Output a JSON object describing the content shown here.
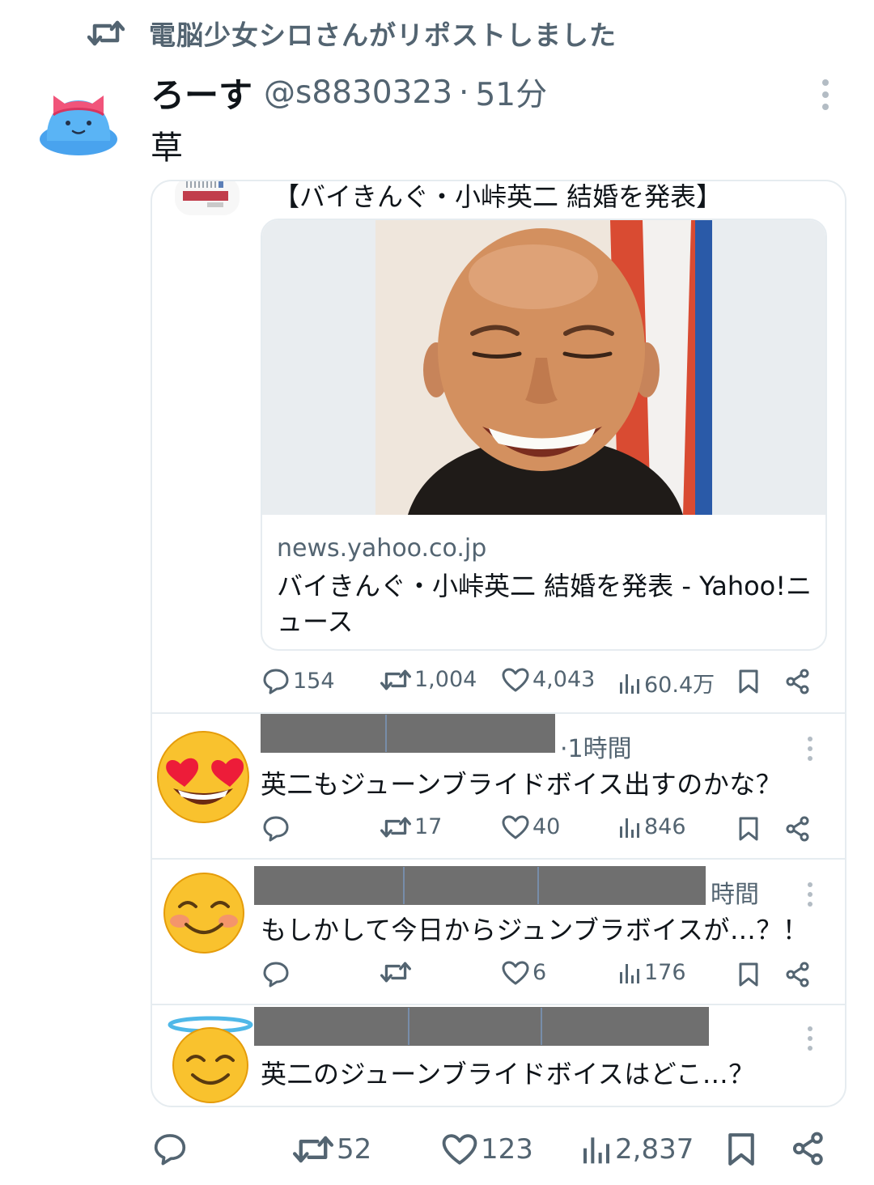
{
  "repost": {
    "icon": "repost-icon",
    "label": "電脳少女シロさんがリポストしました"
  },
  "tweet": {
    "author_name": "ろーす",
    "handle": "@s8830323",
    "separator": "·",
    "time": "51分",
    "text": "草"
  },
  "quote": {
    "header": "【バイきんぐ・小峠英二 結婚を発表】",
    "link": {
      "domain": "news.yahoo.co.jp",
      "title": "バイきんぐ・小峠英二 結婚を発表 - Yahoo!ニュース"
    },
    "stats": {
      "replies": "154",
      "reposts": "1,004",
      "likes": "4,043",
      "views": "60.4万"
    },
    "replies": [
      {
        "emoji": "heart-eyes-emoji",
        "time": "·1時間",
        "text": "英二もジューンブライドボイス出すのかな？",
        "reposts": "17",
        "likes": "40",
        "views": "846"
      },
      {
        "emoji": "smiling-blush-emoji",
        "time": "時間",
        "text": "もしかして今日からジュンブラボイスが…？！",
        "likes": "6",
        "views": "176"
      },
      {
        "emoji": "halo-emoji",
        "text": "英二のジューンブライドボイスはどこ…？"
      }
    ]
  },
  "bottom_stats": {
    "reposts": "52",
    "likes": "123",
    "views": "2,837"
  },
  "colors": {
    "text": "#0f1419",
    "secondary": "#536471",
    "border": "#e6ecf0",
    "redaction": "#6f6f6f"
  }
}
